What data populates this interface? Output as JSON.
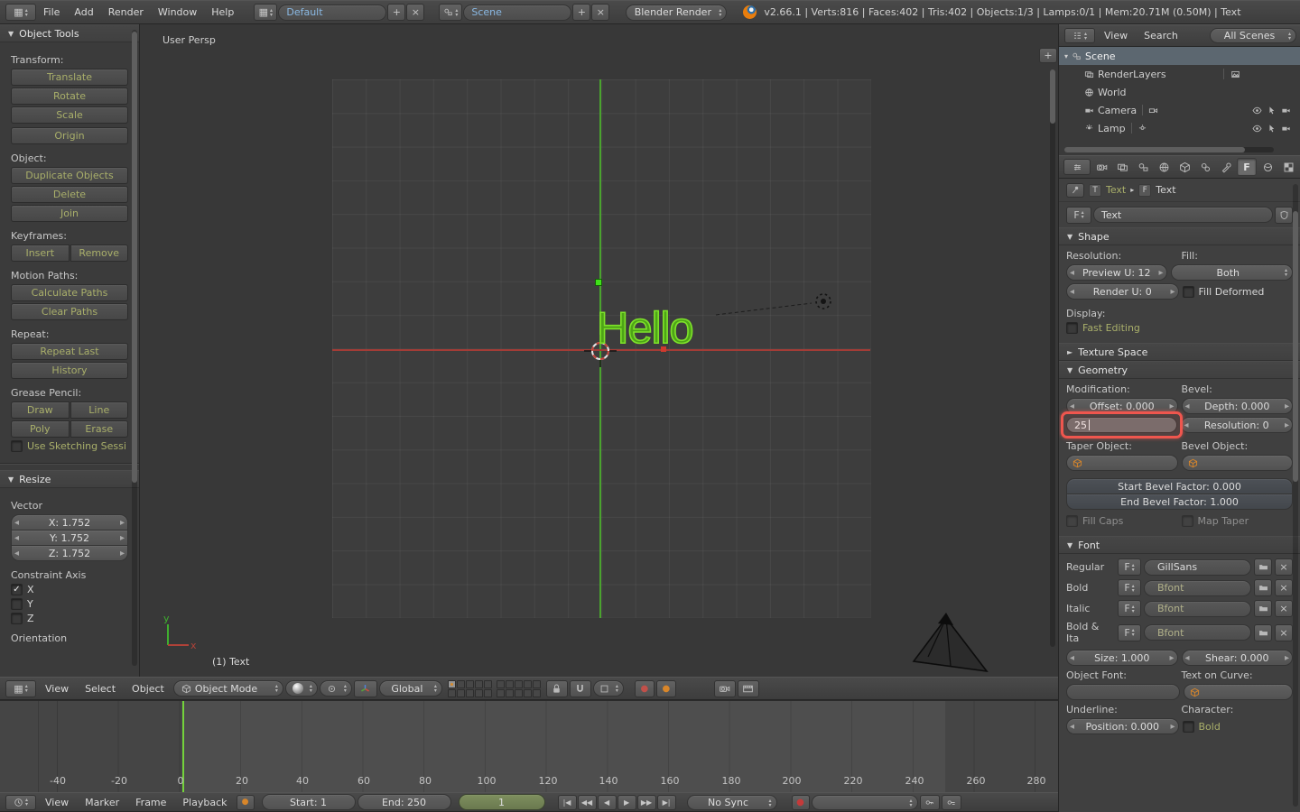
{
  "top_bar": {
    "menu_file": "File",
    "menu_add": "Add",
    "menu_render": "Render",
    "menu_window": "Window",
    "menu_help": "Help",
    "layout_name": "Default",
    "scene_name": "Scene",
    "engine": "Blender Render",
    "stats": "v2.66.1 | Verts:816 | Faces:402 | Tris:402 | Objects:1/3 | Lamps:0/1 | Mem:20.71M (0.50M) | Text"
  },
  "tool_shelf": {
    "title": "Object Tools",
    "transform_label": "Transform:",
    "translate": "Translate",
    "rotate": "Rotate",
    "scale": "Scale",
    "origin": "Origin",
    "object_label": "Object:",
    "duplicate": "Duplicate Objects",
    "delete": "Delete",
    "join": "Join",
    "keyframes_label": "Keyframes:",
    "insert": "Insert",
    "remove": "Remove",
    "motion_paths_label": "Motion Paths:",
    "calculate_paths": "Calculate Paths",
    "clear_paths": "Clear Paths",
    "repeat_label": "Repeat:",
    "repeat_last": "Repeat Last",
    "history": "History",
    "grease_pencil_label": "Grease Pencil:",
    "draw": "Draw",
    "line": "Line",
    "poly": "Poly",
    "erase": "Erase",
    "use_sketching": "Use Sketching Sessi"
  },
  "redo_panel": {
    "title": "Resize",
    "vector_label": "Vector",
    "x": "X: 1.752",
    "y": "Y: 1.752",
    "z": "Z: 1.752",
    "constraint_axis_label": "Constraint Axis",
    "axis_x": "X",
    "axis_y": "Y",
    "axis_z": "Z",
    "orientation_label": "Orientation"
  },
  "viewport": {
    "view_name": "User Persp",
    "active_object": "(1) Text",
    "text_object": "Hello",
    "axis_x_label": "x",
    "axis_y_label": "y"
  },
  "view3d_header": {
    "menu_view": "View",
    "menu_select": "Select",
    "menu_object": "Object",
    "mode": "Object Mode",
    "orientation": "Global"
  },
  "outliner": {
    "menu_view": "View",
    "menu_search": "Search",
    "filter": "All Scenes",
    "scene": "Scene",
    "render_layers": "RenderLayers",
    "world": "World",
    "camera": "Camera",
    "lamp": "Lamp"
  },
  "properties": {
    "crumb_object": "Text",
    "crumb_data": "Text",
    "id_name": "Text",
    "shape_title": "Shape",
    "resolution_label": "Resolution:",
    "fill_label": "Fill:",
    "preview_u": "Preview U: 12",
    "render_u": "Render U: 0",
    "fill_mode": "Both",
    "fill_deformed": "Fill Deformed",
    "display_label": "Display:",
    "fast_editing": "Fast Editing",
    "texture_space_title": "Texture Space",
    "geometry_title": "Geometry",
    "modification_label": "Modification:",
    "bevel_label": "Bevel:",
    "offset": "Offset: 0.000",
    "extrude_value": "25",
    "depth": "Depth: 0.000",
    "resolution": "Resolution: 0",
    "taper_object_label": "Taper Object:",
    "bevel_object_label": "Bevel Object:",
    "start_bevel_factor": "Start Bevel Factor: 0.000",
    "end_bevel_factor": "End Bevel Factor: 1.000",
    "fill_caps": "Fill Caps",
    "map_taper": "Map Taper",
    "font_title": "Font",
    "regular_label": "Regular",
    "bold_label": "Bold",
    "italic_label": "Italic",
    "bold_italic_label": "Bold & Ita",
    "regular_font": "GillSans",
    "bold_font": "Bfont",
    "italic_font": "Bfont",
    "bold_italic_font": "Bfont",
    "size": "Size: 1.000",
    "shear": "Shear: 0.000",
    "object_font_label": "Object Font:",
    "text_on_curve_label": "Text on Curve:",
    "underline_label": "Underline:",
    "character_label": "Character:",
    "position": "Position: 0.000",
    "bold_toggle": "Bold"
  },
  "timeline": {
    "menu_view": "View",
    "menu_marker": "Marker",
    "menu_frame": "Frame",
    "menu_playback": "Playback",
    "start": "Start: 1",
    "end": "End: 250",
    "current_frame": "1",
    "sync": "No Sync",
    "ticks": [
      "-40",
      "-20",
      "0",
      "20",
      "40",
      "60",
      "80",
      "100",
      "120",
      "140",
      "160",
      "180",
      "200",
      "220",
      "240",
      "260",
      "280"
    ]
  },
  "icons": {
    "down_arrow": "▾",
    "up_arrow": "▴",
    "collapse_tri": "▼",
    "expand_tri": "►",
    "crumb_sep": "▸",
    "plus": "+",
    "close": "×",
    "check": "✓",
    "dec": "◂",
    "inc": "▸",
    "jump_start": "|◀",
    "prev_key": "◀◀",
    "play_rev": "◀",
    "play": "▶",
    "next_key": "▶▶",
    "jump_end": "▶|",
    "font_f": "F",
    "text_t": "T",
    "record_dot": "●",
    "grid": "▦"
  },
  "colors": {
    "selection_green": "#55c41c",
    "annotation_red": "#ef564e",
    "frame_line_green": "#74d33c",
    "axis_green": "#4aa32e",
    "axis_red": "#a33c36"
  }
}
